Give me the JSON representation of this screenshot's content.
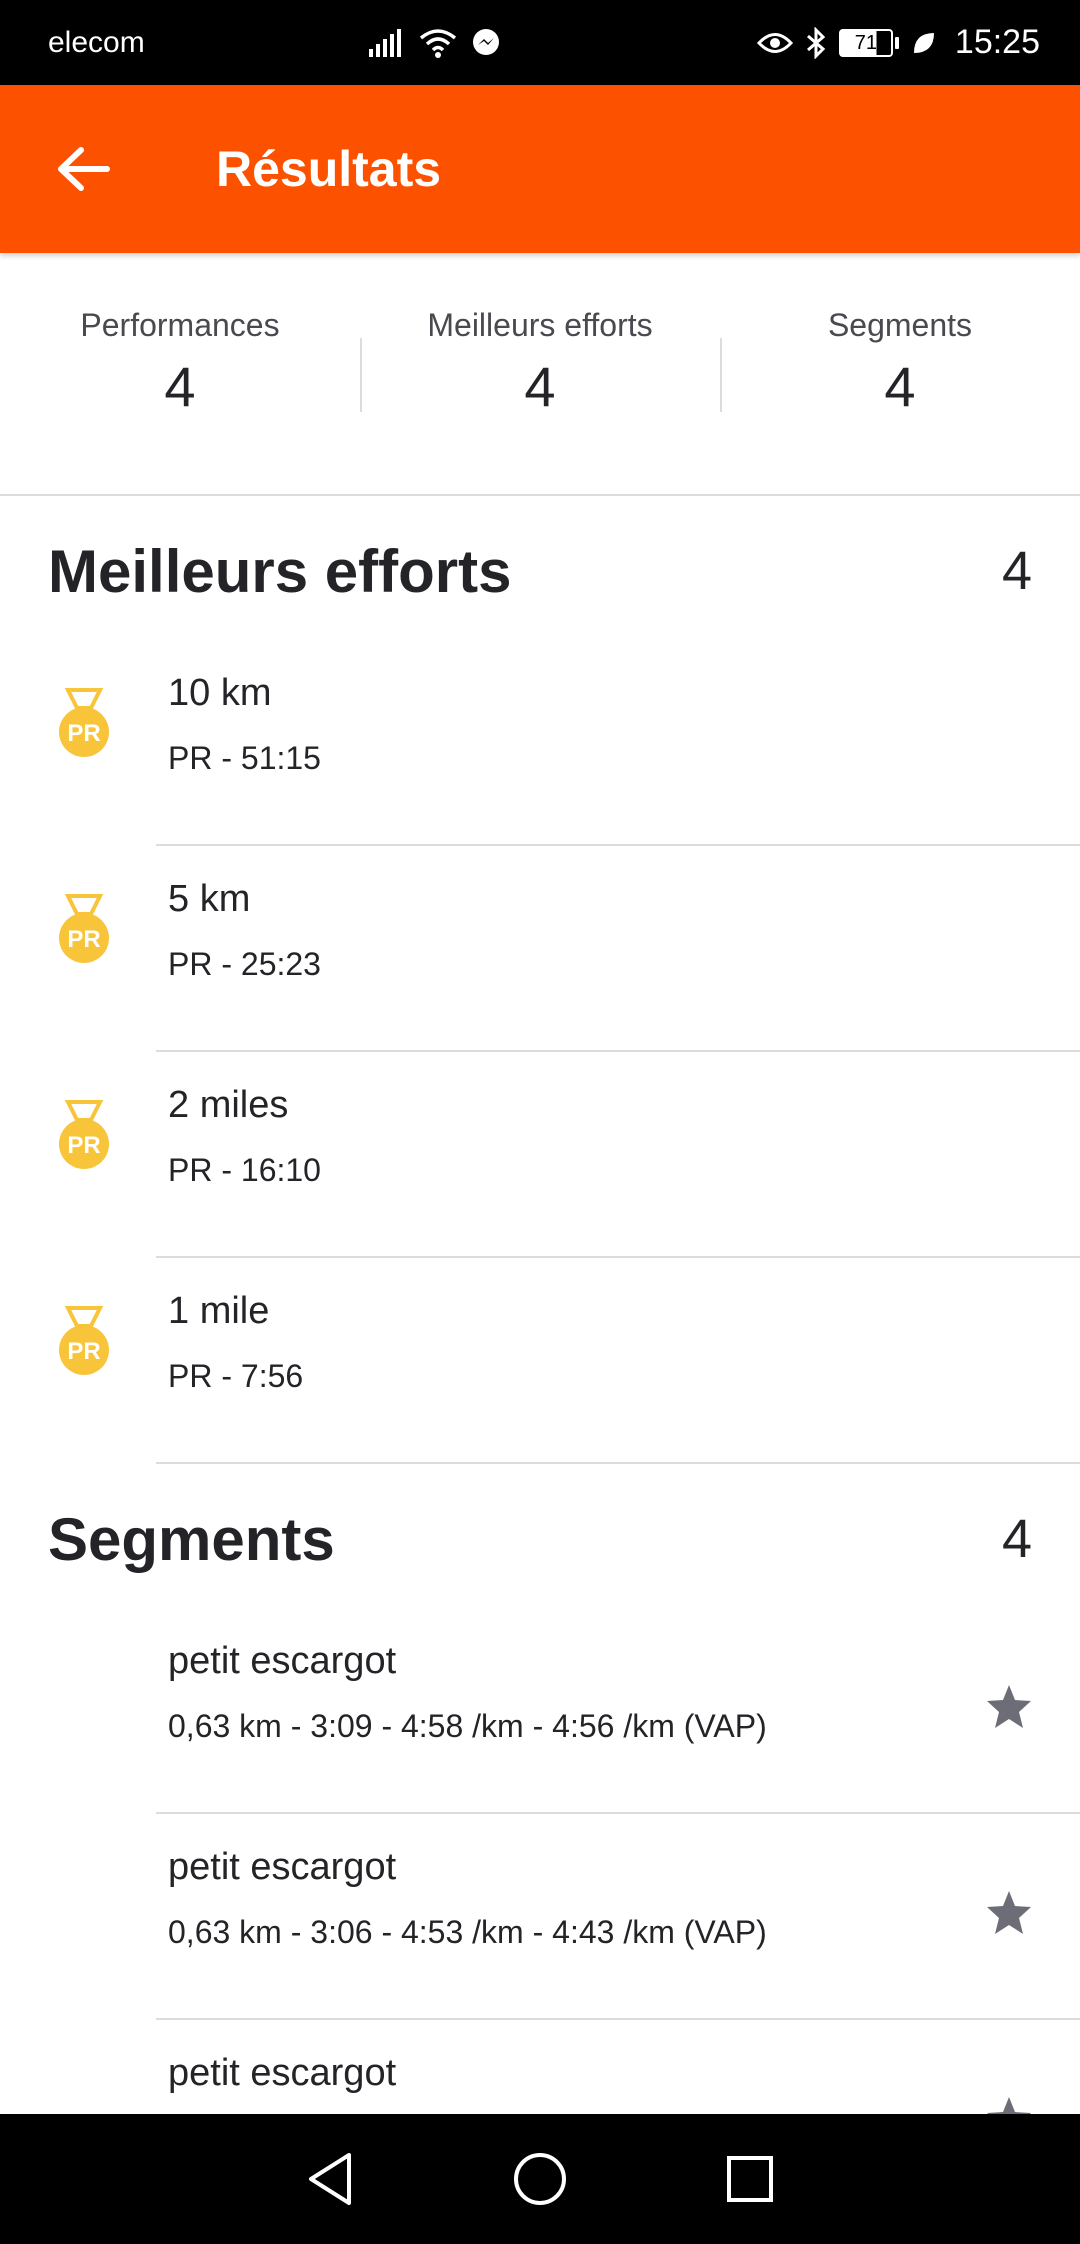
{
  "status_bar": {
    "carrier": "elecom",
    "time": "15:25",
    "battery": "71"
  },
  "app_bar": {
    "title": "Résultats"
  },
  "stats": [
    {
      "label": "Performances",
      "value": "4"
    },
    {
      "label": "Meilleurs efforts",
      "value": "4"
    },
    {
      "label": "Segments",
      "value": "4"
    }
  ],
  "best_efforts": {
    "title": "Meilleurs efforts",
    "count": "4",
    "items": [
      {
        "title": "10 km",
        "subtitle": "PR - 51:15",
        "icon": "pr-medal-icon"
      },
      {
        "title": "5 km",
        "subtitle": "PR - 25:23",
        "icon": "pr-medal-icon"
      },
      {
        "title": "2 miles",
        "subtitle": "PR - 16:10",
        "icon": "pr-medal-icon"
      },
      {
        "title": "1 mile",
        "subtitle": "PR - 7:56",
        "icon": "pr-medal-icon"
      }
    ]
  },
  "segments": {
    "title": "Segments",
    "count": "4",
    "items": [
      {
        "title": "petit escargot",
        "subtitle": "0,63 km - 3:09 - 4:58 /km - 4:56 /km (VAP)",
        "icon": "star-icon"
      },
      {
        "title": "petit escargot",
        "subtitle": "0,63 km - 3:06 - 4:53 /km - 4:43 /km (VAP)",
        "icon": "star-icon"
      },
      {
        "title": "petit escargot",
        "subtitle": "",
        "icon": "star-icon"
      }
    ]
  },
  "colors": {
    "accent": "#fc5200",
    "medal": "#f7c43a",
    "star": "#6d6d78"
  }
}
